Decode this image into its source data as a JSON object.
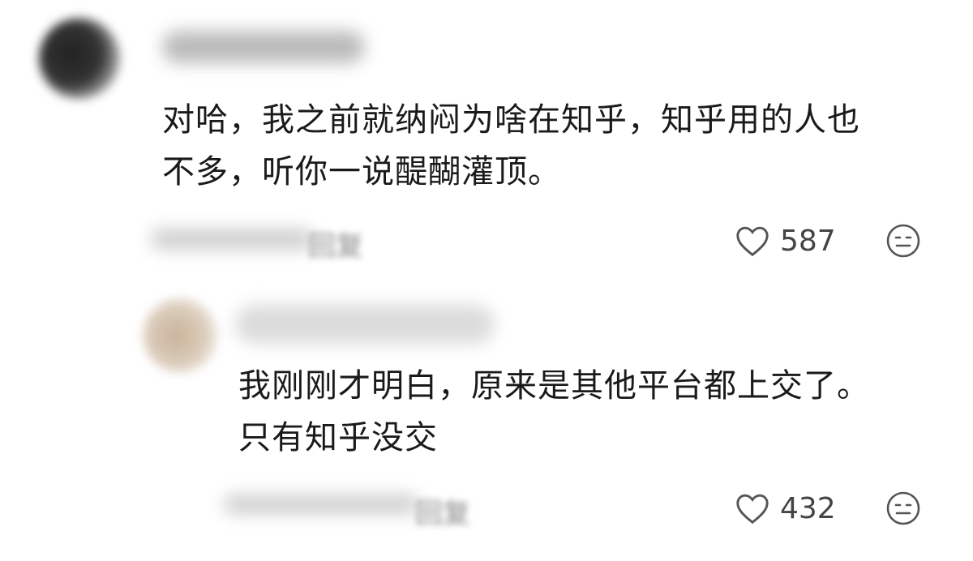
{
  "comments": [
    {
      "text_line1": "对哈，我之前就纳闷为啥在知乎，知乎用的人也",
      "text_line2": "不多，听你一说醍醐灌顶。",
      "likes": "587",
      "reply_label": "回复"
    },
    {
      "text_line1": "我刚刚才明白，原来是其他平台都上交了。",
      "text_line2": "只有知乎没交",
      "likes": "432",
      "reply_label": "回复"
    }
  ],
  "icons": {
    "like": "heart-outline-icon",
    "reaction": "neutral-face-icon"
  },
  "colors": {
    "text": "#1a1a1a",
    "icon": "#555555",
    "blurred": "#9a9a9a"
  }
}
